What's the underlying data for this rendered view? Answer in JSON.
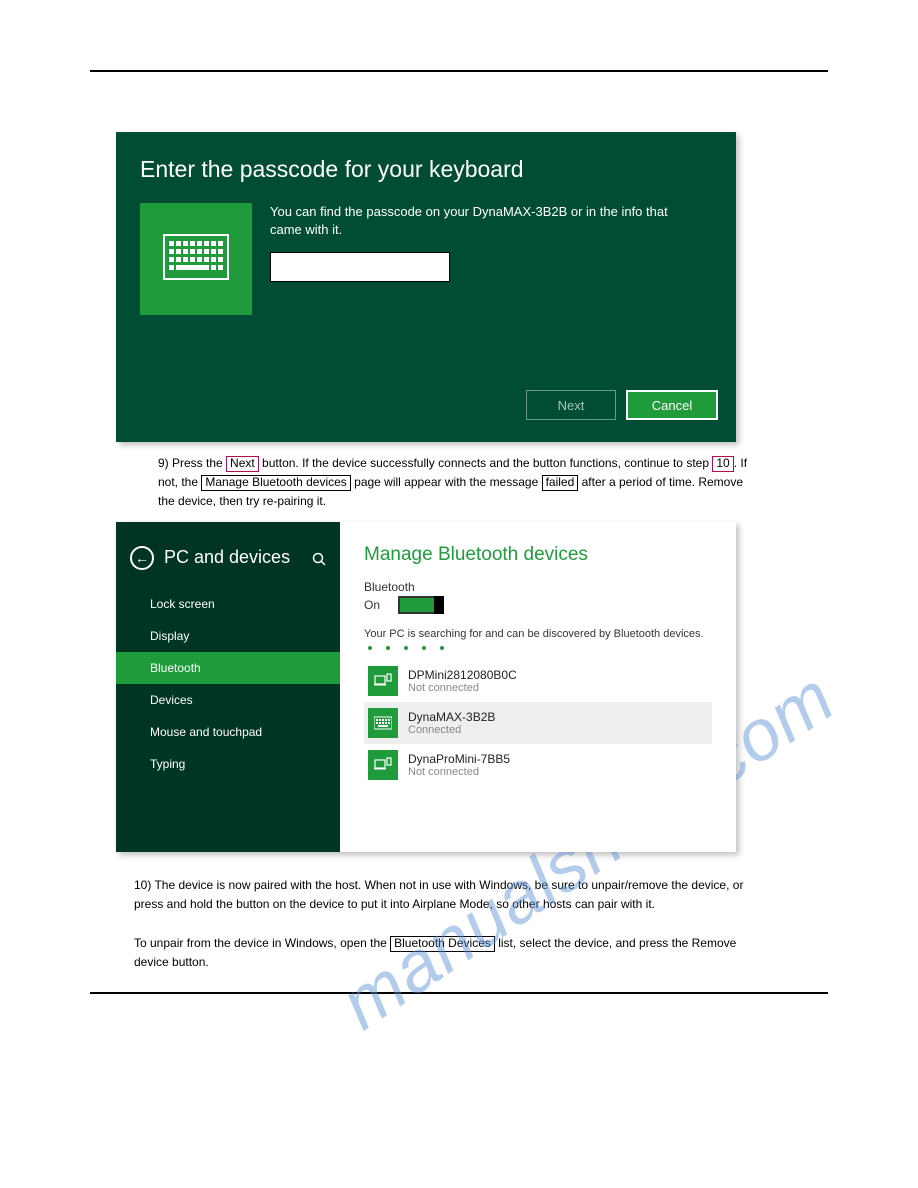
{
  "watermark": "manualshive.com",
  "dialog1": {
    "title": "Enter the passcode for your keyboard",
    "message": "You can find the passcode on your DynaMAX-3B2B or in the info that came with it.",
    "input_value": "",
    "next_label": "Next",
    "cancel_label": "Cancel"
  },
  "para1": {
    "prefix": "9)   Press the ",
    "box1": "Next",
    "mid1": " button. If the device successfully connects and the button functions, continue to step ",
    "box2": "10",
    "mid2": ".  If not, the ",
    "box3": "Manage Bluetooth devices",
    "mid3": " page will appear with the message ",
    "box4": "failed",
    "mid4": " after a period of time.  Remove the device, then try re-pairing it."
  },
  "settings": {
    "title": "PC and devices",
    "nav": [
      "Lock screen",
      "Display",
      "Bluetooth",
      "Devices",
      "Mouse and touchpad",
      "Typing"
    ],
    "active_nav_idx": 2,
    "right_title": "Manage Bluetooth devices",
    "bt_label": "Bluetooth",
    "bt_state": "On",
    "searching": "Your PC is searching for and can be discovered by Bluetooth devices.",
    "devices": [
      {
        "name": "DPMini2812080B0C",
        "status": "Not connected",
        "icon": "device",
        "selected": false
      },
      {
        "name": "DynaMAX-3B2B",
        "status": "Connected",
        "icon": "keyboard",
        "selected": true
      },
      {
        "name": "DynaProMini-7BB5",
        "status": "Not connected",
        "icon": "device",
        "selected": false
      }
    ]
  },
  "para3": {
    "num": "10) ",
    "text": "The device is now paired with the host.  When not in use with Windows, be sure to unpair/remove the device, or press and hold the button on the device to put it into Airplane Mode, so other hosts can pair with it."
  },
  "para4": {
    "prefix": "To unpair from the device in Windows, open the ",
    "box": "Bluetooth Devices",
    "suffix": " list, select the device, and press the Remove device button."
  }
}
